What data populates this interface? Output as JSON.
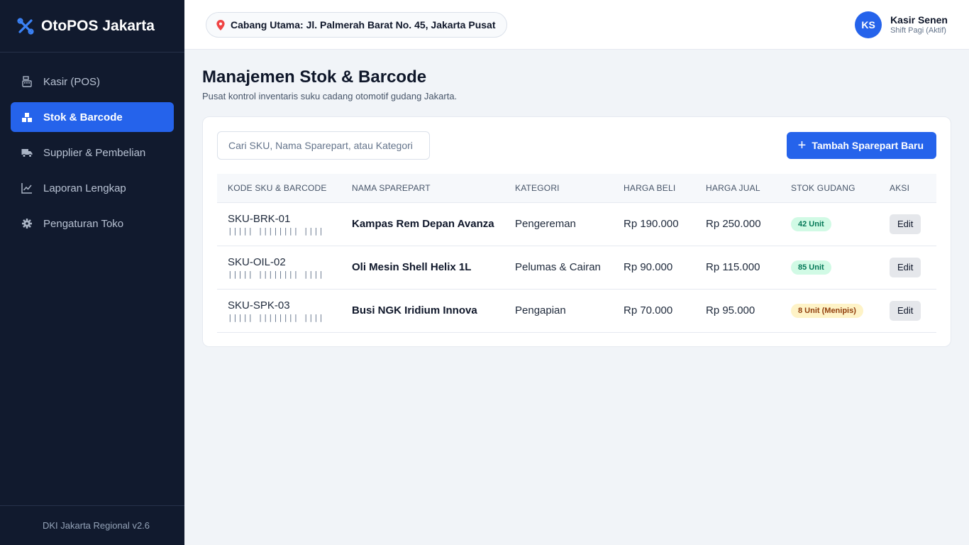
{
  "app": {
    "name": "OtoPOS Jakarta",
    "version": "DKI Jakarta Regional v2.6"
  },
  "sidebar": {
    "items": [
      {
        "label": "Kasir (POS)",
        "icon": "cash-register-icon",
        "active": false
      },
      {
        "label": "Stok & Barcode",
        "icon": "boxes-icon",
        "active": true
      },
      {
        "label": "Supplier & Pembelian",
        "icon": "truck-icon",
        "active": false
      },
      {
        "label": "Laporan Lengkap",
        "icon": "chart-line-icon",
        "active": false
      },
      {
        "label": "Pengaturan Toko",
        "icon": "gear-icon",
        "active": false
      }
    ]
  },
  "header": {
    "branch": "Cabang Utama: Jl. Palmerah Barat No. 45, Jakarta Pusat",
    "user": {
      "initials": "KS",
      "name": "Kasir Senen",
      "shift": "Shift Pagi (Aktif)"
    }
  },
  "main": {
    "title": "Manajemen Stok & Barcode",
    "subtitle": "Pusat kontrol inventaris suku cadang otomotif gudang Jakarta.",
    "search_placeholder": "Cari SKU, Nama Sparepart, atau Kategori",
    "add_button": "Tambah Sparepart Baru",
    "table": {
      "columns": [
        "KODE SKU & BARCODE",
        "NAMA SPAREPART",
        "KATEGORI",
        "HARGA BELI",
        "HARGA JUAL",
        "STOK GUDANG",
        "AKSI"
      ],
      "rows": [
        {
          "sku": "SKU-BRK-01",
          "barcode": "||||| |||||||| ||||",
          "name": "Kampas Rem Depan Avanza",
          "category": "Pengereman",
          "buy": "Rp 190.000",
          "sell": "Rp 250.000",
          "stock": "42 Unit",
          "stock_status": "ok",
          "action": "Edit"
        },
        {
          "sku": "SKU-OIL-02",
          "barcode": "||||| |||||||| ||||",
          "name": "Oli Mesin Shell Helix 1L",
          "category": "Pelumas & Cairan",
          "buy": "Rp 90.000",
          "sell": "Rp 115.000",
          "stock": "85 Unit",
          "stock_status": "ok",
          "action": "Edit"
        },
        {
          "sku": "SKU-SPK-03",
          "barcode": "||||| |||||||| ||||",
          "name": "Busi NGK Iridium Innova",
          "category": "Pengapian",
          "buy": "Rp 70.000",
          "sell": "Rp 95.000",
          "stock": "8 Unit (Menipis)",
          "stock_status": "low",
          "action": "Edit"
        }
      ]
    }
  },
  "colors": {
    "accent": "#2563eb",
    "sidebar_bg": "#111a2e",
    "stock_ok": "#047857",
    "stock_low": "#92400e"
  }
}
